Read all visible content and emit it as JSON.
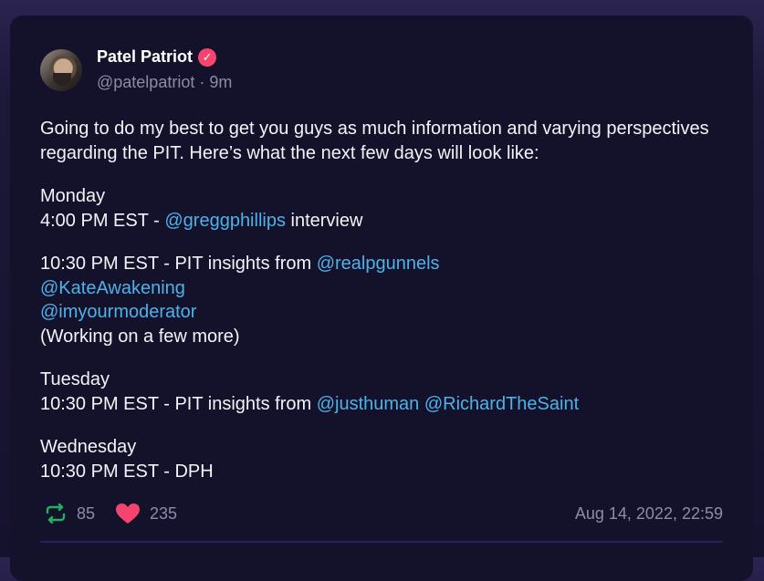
{
  "tweet": {
    "author_name": "Patel Patriot",
    "handle": "@patelpatriot",
    "separator": "·",
    "time_ago": "9m",
    "verified_icon": "verified-badge-icon",
    "accent_color": "#4db2ea",
    "text": {
      "intro": "Going to do my best to get you guys as much information and varying perspectives regarding the PIT. Here’s what the next few days will look like:",
      "monday_label": "Monday",
      "monday_line1_prefix": "4:00 PM EST - ",
      "monday_line1_mention": "@greggphillips",
      "monday_line1_suffix": " interview",
      "monday_line2_prefix": "10:30 PM EST - PIT insights from ",
      "monday_line2_mention": "@realpgunnels",
      "monday_mention_2": "@KateAwakening",
      "monday_mention_3": "@imyourmoderator",
      "monday_note": "(Working on a few more)",
      "tuesday_label": "Tuesday",
      "tuesday_line_prefix": "10:30 PM EST - PIT insights from ",
      "tuesday_mention_1": "@justhuman",
      "tuesday_mention_2": "@RichardTheSaint",
      "wednesday_label": "Wednesday",
      "wednesday_line": "10:30 PM EST - DPH"
    },
    "retweets": "85",
    "likes": "235",
    "timestamp": "Aug 14, 2022, 22:59",
    "retweet_color": "#22b060",
    "like_color": "#f5456e"
  }
}
